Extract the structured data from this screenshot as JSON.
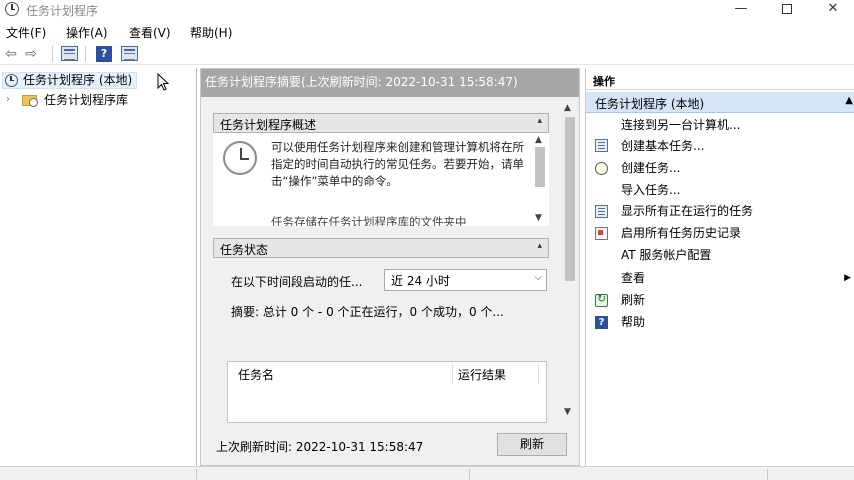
{
  "window": {
    "title": "任务计划程序",
    "minimize": "—",
    "close": "✕"
  },
  "menu": {
    "file": "文件(F)",
    "action": "操作(A)",
    "view": "查看(V)",
    "help": "帮助(H)"
  },
  "toolbar": {
    "back": "⇦",
    "forward": "⇨",
    "help": "?"
  },
  "tree": {
    "root": "任务计划程序 (本地)",
    "child": "任务计划程序库",
    "chevron": "›"
  },
  "main": {
    "header": "任务计划程序摘要(上次刷新时间: 2022-10-31 15:58:47)",
    "overview": {
      "title": "任务计划程序概述",
      "text": "可以使用任务计划程序来创建和管理计算机将在所指定的时间自动执行的常见任务。若要开始，请单击“操作”菜单中的命令。",
      "text2": "任务存储在任务计划程序库的文件夹中"
    },
    "status": {
      "title": "任务状态",
      "period_label": "在以下时间段启动的任...",
      "period_value": "近 24 小时",
      "summary": "摘要: 总计 0 个 - 0 个正在运行，0 个成功，0 个...",
      "columns": [
        "任务名",
        "运行结果"
      ]
    },
    "last_refresh": "上次刷新时间: 2022-10-31 15:58:47",
    "refresh_button": "刷新"
  },
  "actions": {
    "title": "操作",
    "group": "任务计划程序 (本地)",
    "items": [
      "连接到另一台计算机...",
      "创建基本任务...",
      "创建任务...",
      "导入任务...",
      "显示所有正在运行的任务",
      "启用所有任务历史记录",
      "AT 服务帐户配置",
      "查看",
      "刷新",
      "帮助"
    ]
  }
}
